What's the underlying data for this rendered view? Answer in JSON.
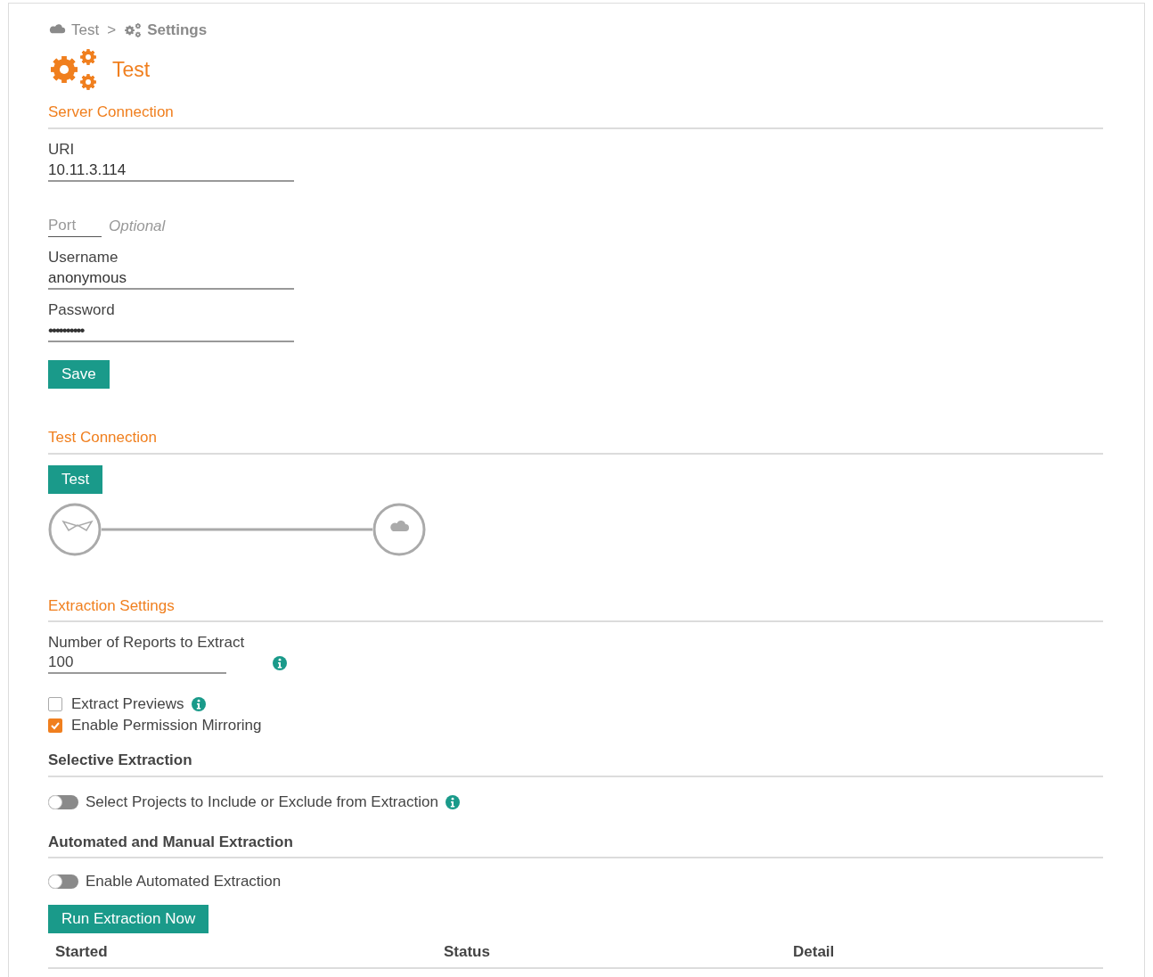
{
  "breadcrumb": [
    {
      "kind": "cloud",
      "label": "Test"
    },
    {
      "kind": "gears",
      "label": "Settings"
    }
  ],
  "breadcrumb_separator": ">",
  "title": "Test",
  "server_connection": {
    "heading": "Server Connection",
    "fields": [
      {
        "label": "URI",
        "value": "10.11.3.114",
        "kind": "text"
      },
      {
        "placeholder": "Port",
        "hint": "Optional",
        "kind": "short"
      },
      {
        "label": "Username",
        "value": "anonymous",
        "kind": "text"
      },
      {
        "label": "Password",
        "value": "••••••••••",
        "kind": "password"
      }
    ],
    "button": "Save"
  },
  "test_connection": {
    "heading": "Test Connection",
    "button": "Test"
  },
  "extraction_settings": {
    "heading": "Extraction Settings",
    "reports_label": "Number of Reports to Extract",
    "reports_value": "100",
    "checkboxes": [
      {
        "label": "Extract Previews",
        "checked": false,
        "info": true
      },
      {
        "label": "Enable Permission Mirroring",
        "checked": true,
        "info": false
      }
    ]
  },
  "selective_extraction": {
    "heading": "Selective Extraction",
    "toggle": {
      "label": "Select Projects to Include or Exclude from Extraction",
      "on": false,
      "info": true
    }
  },
  "automated_extraction": {
    "heading": "Automated and Manual Extraction",
    "toggle": {
      "label": "Enable Automated Extraction",
      "on": false,
      "info": false
    },
    "button": "Run Extraction Now"
  },
  "table": {
    "columns": [
      "Started",
      "Status",
      "Detail"
    ]
  }
}
